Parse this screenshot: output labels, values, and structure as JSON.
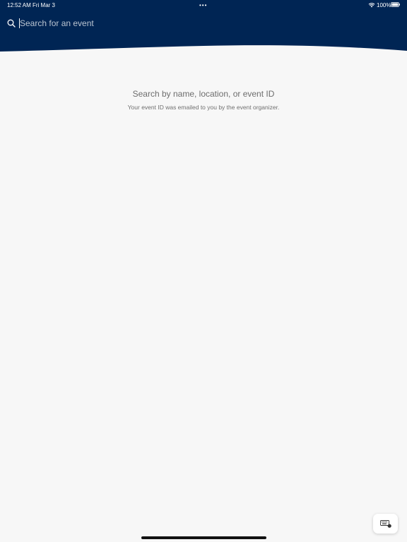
{
  "status_bar": {
    "time": "12:52 AM",
    "date": "Fri Mar 3",
    "dots": "•••",
    "battery": "100%"
  },
  "search": {
    "placeholder": "Search for an event",
    "value": ""
  },
  "empty_state": {
    "title": "Search by name, location, or event ID",
    "subtitle": "Your event ID was emailed to you by the event organizer."
  },
  "colors": {
    "header_bg": "#002554",
    "page_bg": "#f7f7f7",
    "text_muted": "#6d6d6d"
  },
  "icons": {
    "search": "search-icon",
    "wifi": "wifi-icon",
    "battery": "battery-icon",
    "keyboard": "keyboard-icon"
  }
}
